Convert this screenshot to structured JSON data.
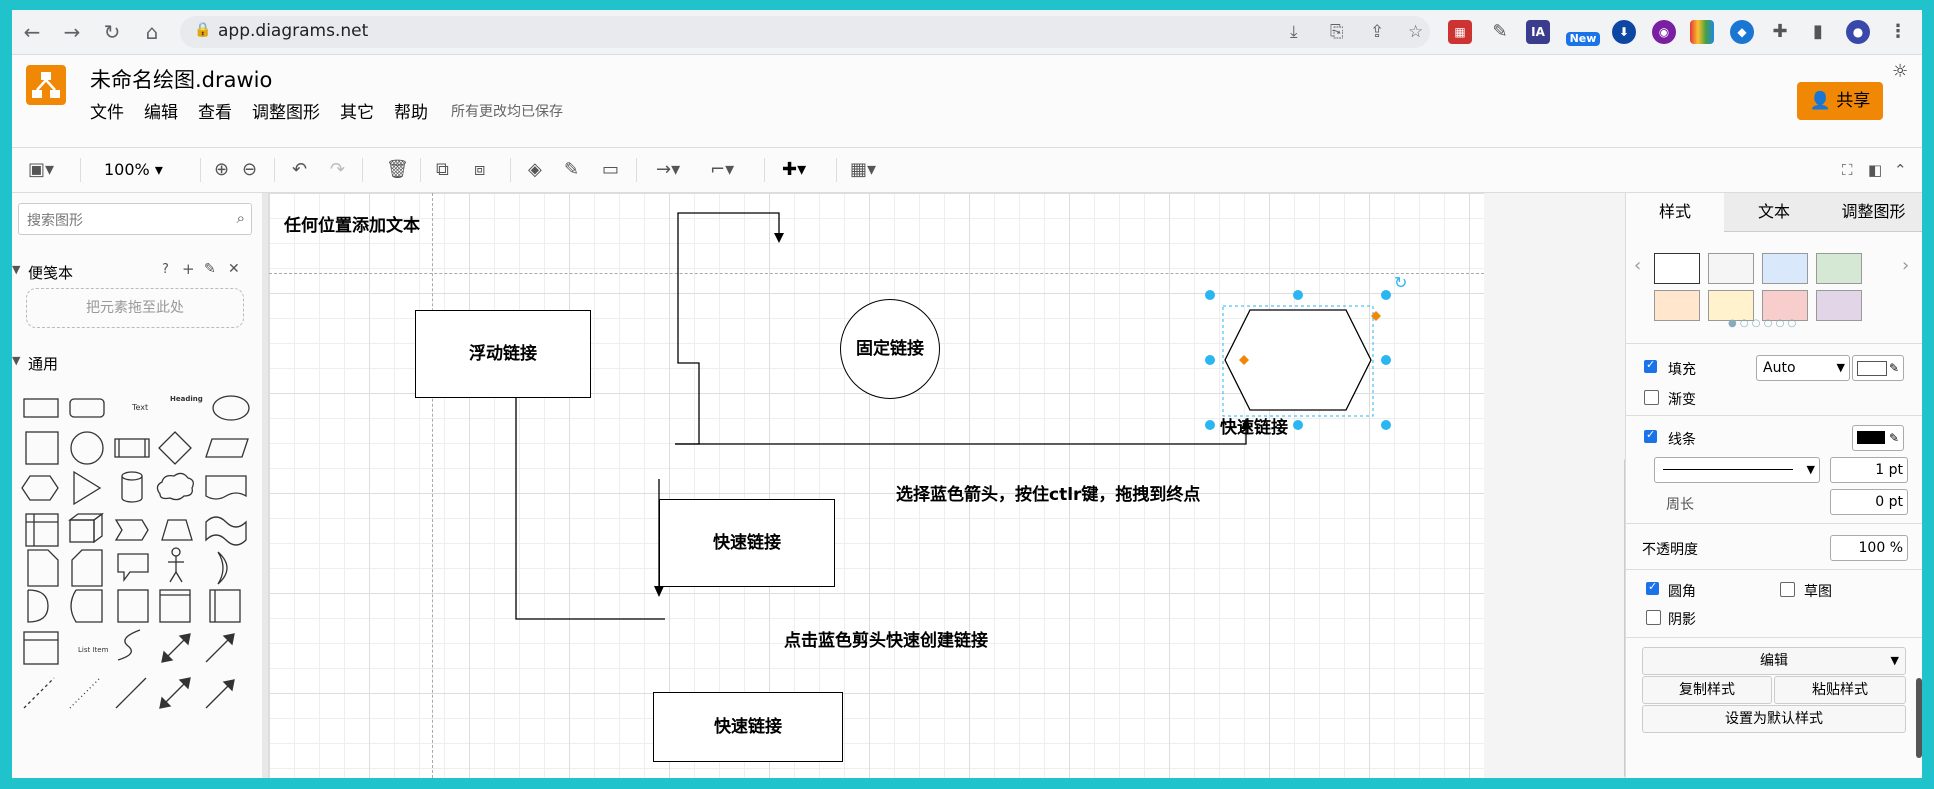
{
  "browser": {
    "url": "app.diagrams.net",
    "new_badge": "New",
    "ia_badge": "IA"
  },
  "app": {
    "title": "未命名绘图.drawio",
    "menu": [
      "文件",
      "编辑",
      "查看",
      "调整图形",
      "其它",
      "帮助"
    ],
    "saved_status": "所有更改均已保存",
    "share_label": "共享",
    "accent": "#f08705"
  },
  "toolbar": {
    "zoom": "100%"
  },
  "left_panel": {
    "search_placeholder": "搜索图形",
    "scratchpad_title": "便笺本",
    "scratchpad_actions": [
      "?",
      "+",
      "✎",
      "✕"
    ],
    "dropzone": "把元素拖至此处",
    "general_title": "通用",
    "shape_text_label": "Text",
    "shape_heading_label": "Heading",
    "shape_list_item_label": "List Item"
  },
  "canvas": {
    "free_text": "任何位置添加文本",
    "floating_link": "浮动链接",
    "fixed_link": "固定链接",
    "quick_link_1": "快速链接",
    "quick_link_2": "快速链接",
    "quick_link_hex": "快速链接",
    "instruction_1": "选择蓝色箭头，按住ctlr键，拖拽到终点",
    "instruction_2": "点击蓝色剪头快速创建链接"
  },
  "right_panel": {
    "tabs": [
      "样式",
      "文本",
      "调整图形"
    ],
    "swatches": [
      "#ffffff",
      "#f5f5f5",
      "#dae8fc",
      "#d5e8d4",
      "#ffe6cc",
      "#fff2cc",
      "#f8cecc",
      "#e1d5e7"
    ],
    "fill_label": "填充",
    "fill_mode": "Auto",
    "gradient_label": "渐变",
    "line_label": "线条",
    "line_width": "1 pt",
    "perimeter_label": "周长",
    "perimeter_value": "0 pt",
    "opacity_label": "不透明度",
    "opacity_value": "100 %",
    "rounded_label": "圆角",
    "sketch_label": "草图",
    "shadow_label": "阴影",
    "edit_label": "编辑",
    "copy_style": "复制样式",
    "paste_style": "粘贴样式",
    "set_default": "设置为默认样式"
  }
}
